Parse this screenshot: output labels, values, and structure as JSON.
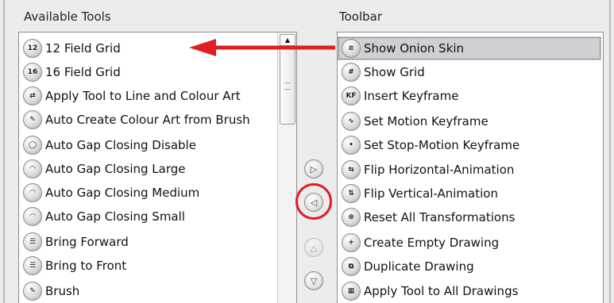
{
  "available_tools": {
    "label": "Available Tools",
    "items": [
      {
        "label": "12 Field Grid",
        "icon": "field-grid-12-icon",
        "glyph": "12"
      },
      {
        "label": "16 Field Grid",
        "icon": "field-grid-16-icon",
        "glyph": "16"
      },
      {
        "label": "Apply Tool to Line and Colour Art",
        "icon": "apply-tool-line-colour-icon",
        "glyph": "⇄"
      },
      {
        "label": "Auto Create Colour Art from Brush",
        "icon": "brush-colour-art-icon",
        "glyph": "✎"
      },
      {
        "label": "Auto Gap Closing Disable",
        "icon": "gap-closing-disable-icon",
        "glyph": "◯"
      },
      {
        "label": "Auto Gap Closing Large",
        "icon": "gap-closing-large-icon",
        "glyph": "◠"
      },
      {
        "label": "Auto Gap Closing Medium",
        "icon": "gap-closing-medium-icon",
        "glyph": "◠"
      },
      {
        "label": "Auto Gap Closing Small",
        "icon": "gap-closing-small-icon",
        "glyph": "◠"
      },
      {
        "label": "Bring Forward",
        "icon": "bring-forward-icon",
        "glyph": "☰"
      },
      {
        "label": "Bring to Front",
        "icon": "bring-to-front-icon",
        "glyph": "☰"
      },
      {
        "label": "Brush",
        "icon": "brush-icon",
        "glyph": "✎"
      }
    ]
  },
  "toolbar": {
    "label": "Toolbar",
    "items": [
      {
        "label": "Show Onion Skin",
        "icon": "onion-skin-icon",
        "glyph": "≋",
        "selected": true
      },
      {
        "label": "Show Grid",
        "icon": "grid-icon",
        "glyph": "#"
      },
      {
        "label": "Insert Keyframe",
        "icon": "insert-keyframe-icon",
        "glyph": "KF"
      },
      {
        "label": "Set Motion Keyframe",
        "icon": "motion-keyframe-icon",
        "glyph": "∿"
      },
      {
        "label": "Set Stop-Motion Keyframe",
        "icon": "stop-motion-keyframe-icon",
        "glyph": "•"
      },
      {
        "label": "Flip Horizontal-Animation",
        "icon": "flip-horizontal-icon",
        "glyph": "⇆"
      },
      {
        "label": "Flip Vertical-Animation",
        "icon": "flip-vertical-icon",
        "glyph": "⇅"
      },
      {
        "label": "Reset All Transformations",
        "icon": "reset-transformations-icon",
        "glyph": "⊕"
      },
      {
        "label": "Create Empty Drawing",
        "icon": "create-empty-drawing-icon",
        "glyph": "+"
      },
      {
        "label": "Duplicate Drawing",
        "icon": "duplicate-drawing-icon",
        "glyph": "⧉"
      },
      {
        "label": "Apply Tool to All Drawings",
        "icon": "apply-all-drawings-icon",
        "glyph": "▦"
      }
    ]
  },
  "controls": {
    "add_glyph": "▷",
    "remove_glyph": "◁",
    "move_up_glyph": "△",
    "move_down_glyph": "▽"
  },
  "annotation": {
    "arrow_color": "#e02020",
    "ring_color": "#e02020"
  }
}
